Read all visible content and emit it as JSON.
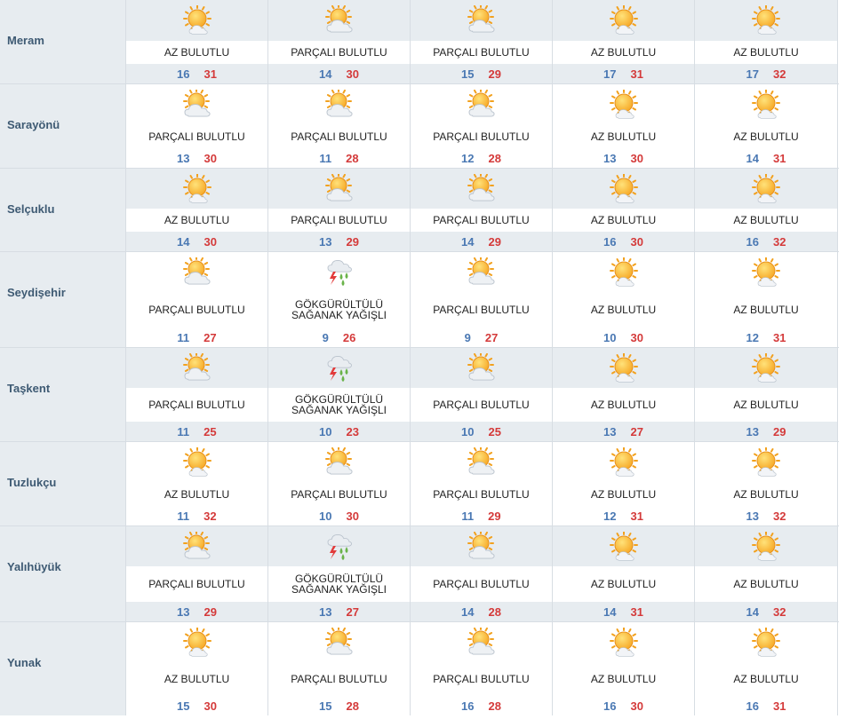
{
  "rows": [
    {
      "city": "Meram",
      "days": [
        {
          "icon": "sun-small-cloud-icon",
          "cond": "AZ BULUTLU",
          "min": "16",
          "max": "31"
        },
        {
          "icon": "sun-cloud-icon",
          "cond": "PARÇALI BULUTLU",
          "min": "14",
          "max": "30"
        },
        {
          "icon": "sun-cloud-icon",
          "cond": "PARÇALI BULUTLU",
          "min": "15",
          "max": "29"
        },
        {
          "icon": "sun-small-cloud-icon",
          "cond": "AZ BULUTLU",
          "min": "17",
          "max": "31"
        },
        {
          "icon": "sun-small-cloud-icon",
          "cond": "AZ BULUTLU",
          "min": "17",
          "max": "32"
        }
      ]
    },
    {
      "city": "Sarayönü",
      "days": [
        {
          "icon": "sun-cloud-icon",
          "cond": "PARÇALI BULUTLU",
          "min": "13",
          "max": "30"
        },
        {
          "icon": "sun-cloud-icon",
          "cond": "PARÇALI BULUTLU",
          "min": "11",
          "max": "28"
        },
        {
          "icon": "sun-cloud-icon",
          "cond": "PARÇALI BULUTLU",
          "min": "12",
          "max": "28"
        },
        {
          "icon": "sun-small-cloud-icon",
          "cond": "AZ BULUTLU",
          "min": "13",
          "max": "30"
        },
        {
          "icon": "sun-small-cloud-icon",
          "cond": "AZ BULUTLU",
          "min": "14",
          "max": "31"
        }
      ]
    },
    {
      "city": "Selçuklu",
      "days": [
        {
          "icon": "sun-small-cloud-icon",
          "cond": "AZ BULUTLU",
          "min": "14",
          "max": "30"
        },
        {
          "icon": "sun-cloud-icon",
          "cond": "PARÇALI BULUTLU",
          "min": "13",
          "max": "29"
        },
        {
          "icon": "sun-cloud-icon",
          "cond": "PARÇALI BULUTLU",
          "min": "14",
          "max": "29"
        },
        {
          "icon": "sun-small-cloud-icon",
          "cond": "AZ BULUTLU",
          "min": "16",
          "max": "30"
        },
        {
          "icon": "sun-small-cloud-icon",
          "cond": "AZ BULUTLU",
          "min": "16",
          "max": "32"
        }
      ]
    },
    {
      "city": "Seydişehir",
      "days": [
        {
          "icon": "sun-cloud-icon",
          "cond": "PARÇALI BULUTLU",
          "min": "11",
          "max": "27"
        },
        {
          "icon": "thunder-rain-icon",
          "cond": "GÖKGÜRÜLTÜLÜ SAĞANAK YAĞIŞLI",
          "min": "9",
          "max": "26"
        },
        {
          "icon": "sun-cloud-icon",
          "cond": "PARÇALI BULUTLU",
          "min": "9",
          "max": "27"
        },
        {
          "icon": "sun-small-cloud-icon",
          "cond": "AZ BULUTLU",
          "min": "10",
          "max": "30"
        },
        {
          "icon": "sun-small-cloud-icon",
          "cond": "AZ BULUTLU",
          "min": "12",
          "max": "31"
        }
      ]
    },
    {
      "city": "Taşkent",
      "days": [
        {
          "icon": "sun-cloud-icon",
          "cond": "PARÇALI BULUTLU",
          "min": "11",
          "max": "25"
        },
        {
          "icon": "thunder-rain-icon",
          "cond": "GÖKGÜRÜLTÜLÜ SAĞANAK YAĞIŞLI",
          "min": "10",
          "max": "23"
        },
        {
          "icon": "sun-cloud-icon",
          "cond": "PARÇALI BULUTLU",
          "min": "10",
          "max": "25"
        },
        {
          "icon": "sun-small-cloud-icon",
          "cond": "AZ BULUTLU",
          "min": "13",
          "max": "27"
        },
        {
          "icon": "sun-small-cloud-icon",
          "cond": "AZ BULUTLU",
          "min": "13",
          "max": "29"
        }
      ]
    },
    {
      "city": "Tuzlukçu",
      "days": [
        {
          "icon": "sun-small-cloud-icon",
          "cond": "AZ BULUTLU",
          "min": "11",
          "max": "32"
        },
        {
          "icon": "sun-cloud-icon",
          "cond": "PARÇALI BULUTLU",
          "min": "10",
          "max": "30"
        },
        {
          "icon": "sun-cloud-icon",
          "cond": "PARÇALI BULUTLU",
          "min": "11",
          "max": "29"
        },
        {
          "icon": "sun-small-cloud-icon",
          "cond": "AZ BULUTLU",
          "min": "12",
          "max": "31"
        },
        {
          "icon": "sun-small-cloud-icon",
          "cond": "AZ BULUTLU",
          "min": "13",
          "max": "32"
        }
      ]
    },
    {
      "city": "Yalıhüyük",
      "days": [
        {
          "icon": "sun-cloud-icon",
          "cond": "PARÇALI BULUTLU",
          "min": "13",
          "max": "29"
        },
        {
          "icon": "thunder-rain-icon",
          "cond": "GÖKGÜRÜLTÜLÜ SAĞANAK YAĞIŞLI",
          "min": "13",
          "max": "27"
        },
        {
          "icon": "sun-cloud-icon",
          "cond": "PARÇALI BULUTLU",
          "min": "14",
          "max": "28"
        },
        {
          "icon": "sun-small-cloud-icon",
          "cond": "AZ BULUTLU",
          "min": "14",
          "max": "31"
        },
        {
          "icon": "sun-small-cloud-icon",
          "cond": "AZ BULUTLU",
          "min": "14",
          "max": "32"
        }
      ]
    },
    {
      "city": "Yunak",
      "days": [
        {
          "icon": "sun-small-cloud-icon",
          "cond": "AZ BULUTLU",
          "min": "15",
          "max": "30"
        },
        {
          "icon": "sun-cloud-icon",
          "cond": "PARÇALI BULUTLU",
          "min": "15",
          "max": "28"
        },
        {
          "icon": "sun-cloud-icon",
          "cond": "PARÇALI BULUTLU",
          "min": "16",
          "max": "28"
        },
        {
          "icon": "sun-small-cloud-icon",
          "cond": "AZ BULUTLU",
          "min": "16",
          "max": "30"
        },
        {
          "icon": "sun-small-cloud-icon",
          "cond": "AZ BULUTLU",
          "min": "16",
          "max": "31"
        }
      ]
    }
  ],
  "colors": {
    "city_text": "#3e5a73",
    "min_temp": "#4a78b3",
    "max_temp": "#d43a3a",
    "shade": "#e7ecf0"
  }
}
